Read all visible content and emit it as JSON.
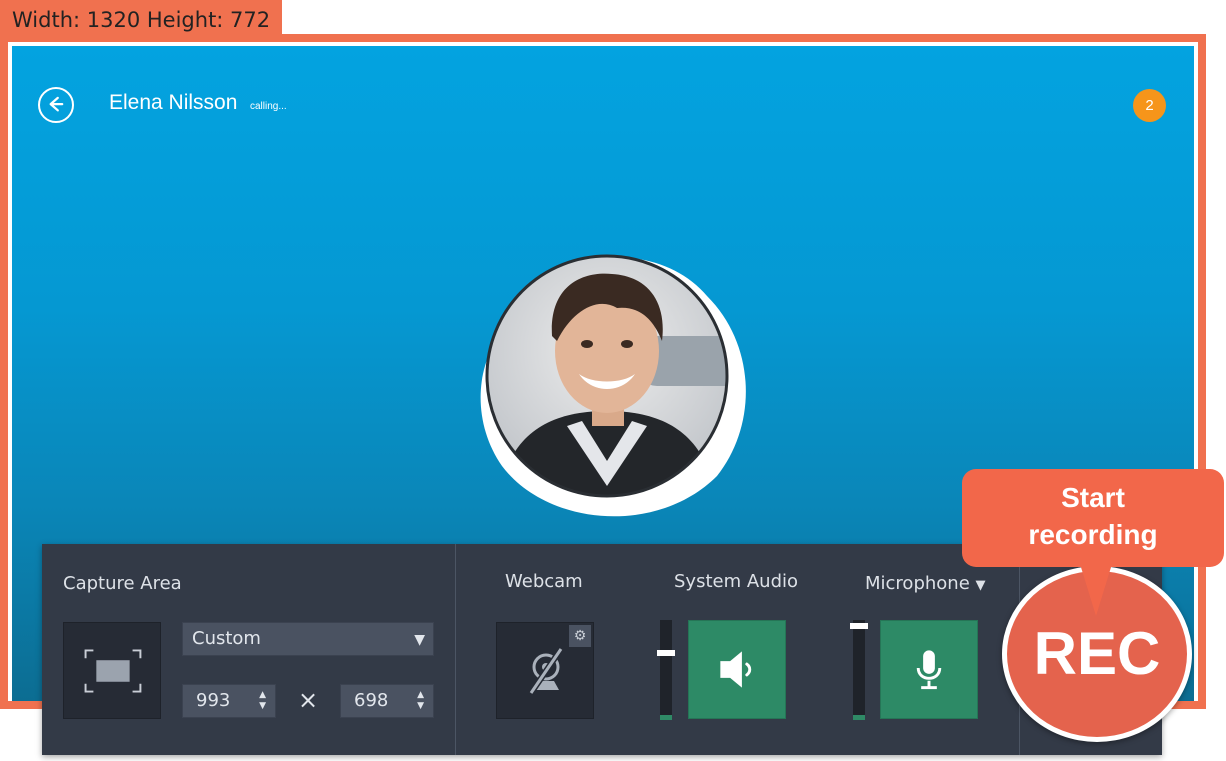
{
  "dimension_tag": "Width: 1320 Height: 772",
  "call": {
    "caller_name": "Elena Nilsson",
    "status": "calling...",
    "notification_count": "2"
  },
  "recorder": {
    "capture_area": {
      "label": "Capture Area",
      "preset": "Custom",
      "width_value": "993",
      "height_value": "698",
      "separator": "×"
    },
    "webcam": {
      "label": "Webcam",
      "state": "off"
    },
    "system_audio": {
      "label": "System Audio",
      "level_percent": 70
    },
    "microphone": {
      "label": "Microphone",
      "dropdown_arrow": "▼",
      "level_percent": 97
    }
  },
  "rec_button": {
    "label": "REC"
  },
  "callout": {
    "line1": "Start",
    "line2": "recording"
  },
  "colors": {
    "accent_orange": "#f0714f",
    "call_blue": "#03a3e0",
    "rec_red": "#e4634d",
    "panel_bg": "#333a47",
    "audio_green": "#2d8a66"
  }
}
